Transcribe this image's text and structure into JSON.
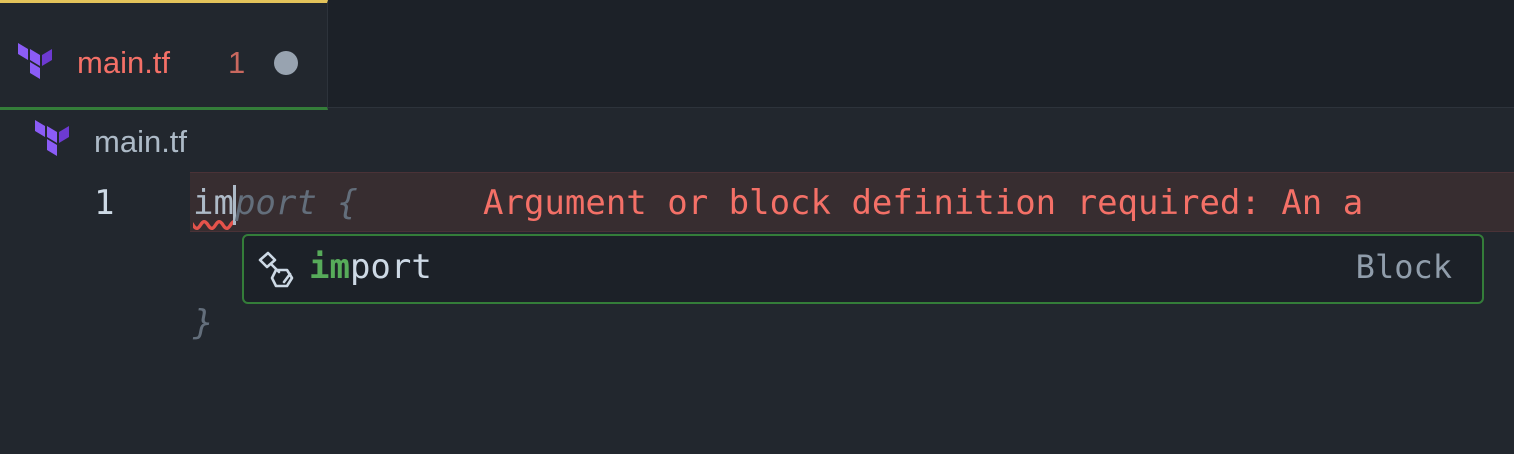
{
  "tab": {
    "filename": "main.tf",
    "problem_count": "1",
    "icon": "terraform-icon",
    "modified": true
  },
  "breadcrumb": {
    "icon": "terraform-icon",
    "label": "main.tf"
  },
  "editor": {
    "line_number": "1",
    "typed_text": "im",
    "ghost_text": "port {",
    "closing_brace": "}",
    "diagnostic": "Argument or block definition required: An a"
  },
  "suggest": {
    "icon": "snippet-icon",
    "match": "im",
    "rest": "port",
    "kind": "Block"
  },
  "colors": {
    "terraform_purple": "#7b42bc",
    "error_red": "#f47067",
    "match_green": "#57ab5a",
    "active_tab_border": "#347d39",
    "tab_top_border": "#e3c35a"
  }
}
